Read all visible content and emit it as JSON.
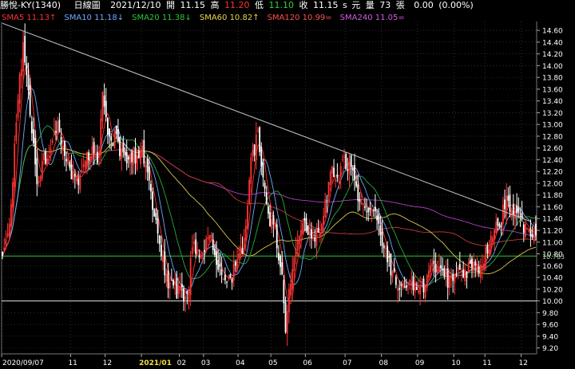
{
  "header": {
    "stock": "勝悅-KY(1340)",
    "chart_type": "日線圖",
    "date": "2021/12/10",
    "open_label": "開",
    "open": "11.15",
    "high_label": "高",
    "high": "11.20",
    "low_label": "低",
    "low": "11.10",
    "close_label": "收",
    "close": "11.15",
    "close_mark": "s",
    "currency": "元",
    "volume_label": "量",
    "volume": "73",
    "volume_unit": "張",
    "change": "0.00",
    "change_pct": "(0.00%)"
  },
  "moving_averages": [
    {
      "label": "SMA5",
      "value": "11.13",
      "arrow": "↑",
      "color": "#ff3030"
    },
    {
      "label": "SMA10",
      "value": "11.18",
      "arrow": "↓",
      "color": "#6fa8ff"
    },
    {
      "label": "SMA20",
      "value": "11.38",
      "arrow": "↓",
      "color": "#2cc83a"
    },
    {
      "label": "SMA60",
      "value": "10.82",
      "arrow": "↑",
      "color": "#e6d84a"
    },
    {
      "label": "SMA120",
      "value": "10.99",
      "arrow": "=",
      "color": "#ff5050"
    },
    {
      "label": "SMA240",
      "value": "11.05",
      "arrow": "=",
      "color": "#d25ce0"
    }
  ],
  "colors": {
    "up": "#ff3333",
    "down": "#ffffff",
    "grid": "#4a4a4a",
    "axis_text": "#ffffff",
    "trendline": "#c8c8c8",
    "level_line": "#e0e0e0",
    "green_line": "#3bbf3b"
  },
  "chart_data": {
    "type": "candlestick",
    "y_range": [
      9.1,
      14.75
    ],
    "y_ticks": [
      "14.60",
      "14.40",
      "14.20",
      "14.00",
      "13.80",
      "13.60",
      "13.40",
      "13.20",
      "13.00",
      "12.80",
      "12.60",
      "12.40",
      "12.20",
      "12.00",
      "11.80",
      "11.60",
      "11.40",
      "11.20",
      "11.00",
      "10.80",
      "10.60",
      "10.40",
      "10.20",
      "10.00",
      "9.80",
      "9.60",
      "9.40",
      "9.20"
    ],
    "x_labels": [
      {
        "label": "2020/09/07",
        "index": 0
      },
      {
        "label": "11",
        "index": 40
      },
      {
        "label": "12",
        "index": 60
      },
      {
        "label": "2021/01",
        "index": 81
      },
      {
        "label": "02",
        "index": 103
      },
      {
        "label": "03",
        "index": 117
      },
      {
        "label": "04",
        "index": 137
      },
      {
        "label": "05",
        "index": 156
      },
      {
        "label": "06",
        "index": 176
      },
      {
        "label": "07",
        "index": 199
      },
      {
        "label": "08",
        "index": 220
      },
      {
        "label": "09",
        "index": 241
      },
      {
        "label": "10",
        "index": 262
      },
      {
        "label": "11",
        "index": 280
      },
      {
        "label": "12",
        "index": 301
      }
    ],
    "highlight_label": "2021/01",
    "green_level": {
      "value": 10.763,
      "label": "10.763"
    },
    "white_level": 10.0,
    "trendline": {
      "from": [
        0,
        14.72
      ],
      "to": [
        306,
        11.35
      ]
    },
    "num_bars": 310,
    "anchors": [
      [
        0,
        10.9
      ],
      [
        4,
        11.2
      ],
      [
        8,
        13.1
      ],
      [
        12,
        14.4
      ],
      [
        16,
        13.2
      ],
      [
        20,
        12.0
      ],
      [
        24,
        12.4
      ],
      [
        28,
        12.6
      ],
      [
        32,
        13.0
      ],
      [
        36,
        12.4
      ],
      [
        40,
        12.2
      ],
      [
        44,
        12.1
      ],
      [
        48,
        12.4
      ],
      [
        52,
        12.6
      ],
      [
        56,
        12.4
      ],
      [
        58,
        13.6
      ],
      [
        60,
        13.2
      ],
      [
        62,
        12.7
      ],
      [
        66,
        12.8
      ],
      [
        70,
        12.4
      ],
      [
        76,
        12.4
      ],
      [
        80,
        12.6
      ],
      [
        84,
        12.2
      ],
      [
        88,
        11.5
      ],
      [
        92,
        10.8
      ],
      [
        96,
        10.3
      ],
      [
        100,
        10.2
      ],
      [
        104,
        10.1
      ],
      [
        108,
        10.2
      ],
      [
        110,
        11.0
      ],
      [
        114,
        10.8
      ],
      [
        118,
        11.0
      ],
      [
        122,
        11.0
      ],
      [
        126,
        10.5
      ],
      [
        130,
        10.3
      ],
      [
        134,
        10.5
      ],
      [
        140,
        11.0
      ],
      [
        144,
        12.4
      ],
      [
        148,
        12.8
      ],
      [
        150,
        12.2
      ],
      [
        154,
        11.4
      ],
      [
        158,
        11.2
      ],
      [
        162,
        10.4
      ],
      [
        164,
        9.6
      ],
      [
        166,
        10.2
      ],
      [
        170,
        10.8
      ],
      [
        174,
        11.4
      ],
      [
        178,
        11.2
      ],
      [
        182,
        11.1
      ],
      [
        186,
        11.4
      ],
      [
        190,
        12.2
      ],
      [
        194,
        12.0
      ],
      [
        198,
        12.4
      ],
      [
        202,
        12.2
      ],
      [
        206,
        11.8
      ],
      [
        210,
        11.5
      ],
      [
        216,
        11.4
      ],
      [
        220,
        11.0
      ],
      [
        224,
        10.6
      ],
      [
        228,
        10.3
      ],
      [
        232,
        10.2
      ],
      [
        238,
        10.3
      ],
      [
        244,
        10.2
      ],
      [
        248,
        10.5
      ],
      [
        252,
        10.6
      ],
      [
        256,
        10.4
      ],
      [
        260,
        10.3
      ],
      [
        264,
        10.5
      ],
      [
        268,
        10.5
      ],
      [
        272,
        10.6
      ],
      [
        276,
        10.6
      ],
      [
        280,
        10.8
      ],
      [
        284,
        11.2
      ],
      [
        288,
        11.3
      ],
      [
        292,
        11.7
      ],
      [
        296,
        11.6
      ],
      [
        300,
        11.3
      ],
      [
        304,
        11.2
      ],
      [
        309,
        11.15
      ]
    ]
  }
}
